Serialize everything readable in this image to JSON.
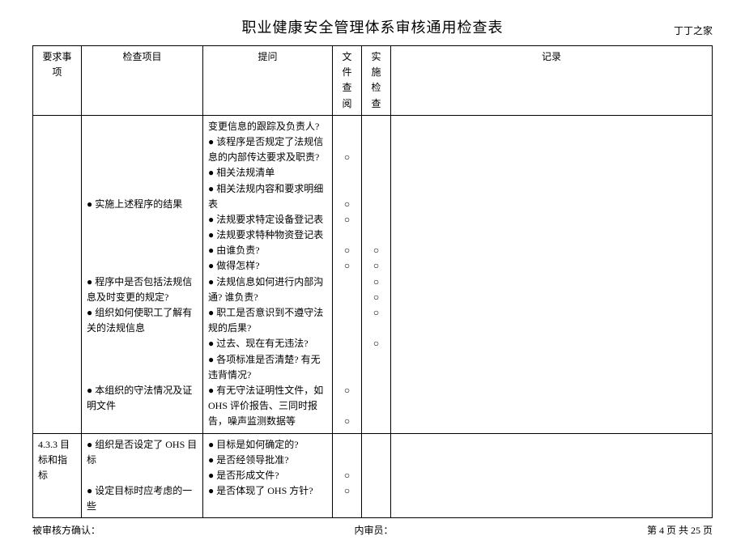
{
  "header": {
    "title": "职业健康安全管理体系审核通用检查表",
    "subtitle": "丁丁之家"
  },
  "columns": {
    "c1": "要求事项",
    "c2": "检查项目",
    "c3": "提问",
    "c4": "文件查阅",
    "c5": "实施检查",
    "c6": "记录"
  },
  "row1": {
    "req": "",
    "items": {
      "i1": "实施上述程序的结果",
      "i2": "程序中是否包括法规信息及时变更的规定?",
      "i3": "组织如何使职工了解有关的法规信息",
      "i4": "本组织的守法情况及证明文件"
    },
    "questions": {
      "q1": "变更信息的跟踪及负责人?",
      "q2": "该程序是否规定了法规信息的内部传达要求及职责?",
      "q3": "相关法规清单",
      "q4": "相关法规内容和要求明细表",
      "q5": "法规要求特定设备登记表",
      "q6": "法规要求特种物资登记表",
      "q7": "由谁负责?",
      "q8": "做得怎样?",
      "q9": "法规信息如何进行内部沟通? 谁负责?",
      "q10": "职工是否意识到不遵守法规的后果?",
      "q11": "过去、现在有无违法?",
      "q12": "各项标准是否清楚? 有无违背情况?",
      "q13": "有无守法证明性文件，如OHS 评价报告、三同时报告，噪声监测数据等"
    },
    "doc": {
      "q2": "○",
      "q3": "○",
      "q4": "○",
      "q5": "○",
      "q6": "○",
      "q12": "○",
      "q13": "○"
    },
    "impl": {
      "q5": "○",
      "q6": "○",
      "q7": "○",
      "q8": "○",
      "q9": "○",
      "q10": "○"
    }
  },
  "row2": {
    "req": "4.3.3 目标和指标",
    "items": {
      "i1": "组织是否设定了 OHS 目标",
      "i2": "设定目标时应考虑的一些"
    },
    "questions": {
      "q1": "目标是如何确定的?",
      "q2": "是否经领导批准?",
      "q3": "是否形成文件?",
      "q4": "是否体现了 OHS 方针?"
    },
    "doc": {
      "q3": "○",
      "q4": "○"
    }
  },
  "footer": {
    "left": "被审核方确认：",
    "middle": "内审员：",
    "right": "第 4 页 共 25 页"
  }
}
